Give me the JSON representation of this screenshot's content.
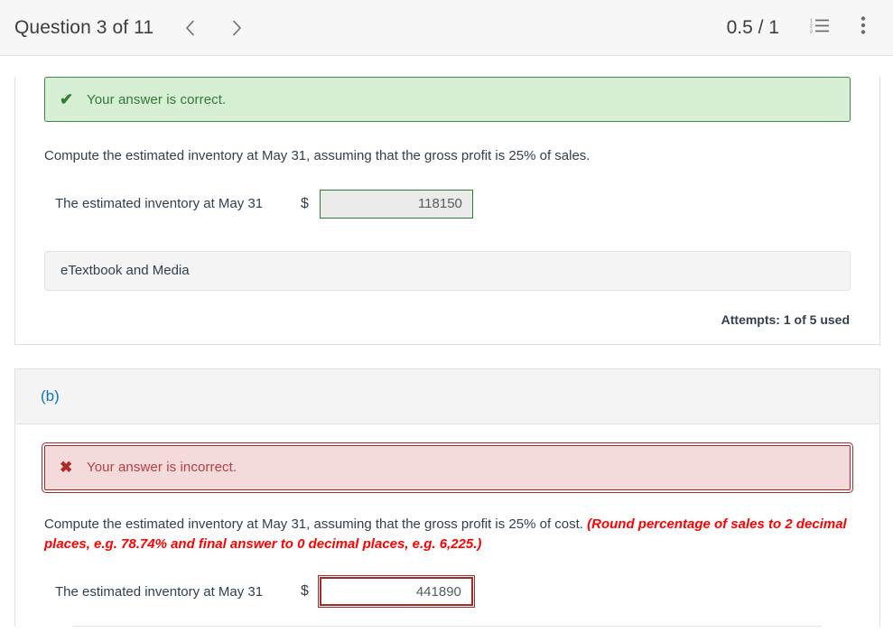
{
  "header": {
    "question_title": "Question 3 of 11",
    "prev_icon": "chevron-left-icon",
    "next_icon": "chevron-right-icon",
    "score": "0.5 / 1",
    "list_icon": "numbered-list-icon",
    "menu_icon": "kebab-menu-icon"
  },
  "part_a": {
    "alert": {
      "icon": "check-icon",
      "icon_glyph": "✔",
      "text": "Your answer is correct."
    },
    "prompt": "Compute the estimated inventory at May 31, assuming that the gross profit is 25% of sales.",
    "answer": {
      "label": "The estimated inventory at May 31",
      "currency": "$",
      "value": "118150",
      "placeholder": ""
    },
    "etextbook": "eTextbook and Media",
    "attempts": "Attempts: 1 of 5 used"
  },
  "part_b": {
    "label": "(b)",
    "alert": {
      "icon": "x-icon",
      "icon_glyph": "✖",
      "text": "Your answer is incorrect."
    },
    "prompt": "Compute the estimated inventory at May 31, assuming that the gross profit is 25% of cost.",
    "prompt_hint": "(Round percentage of sales to 2 decimal places, e.g. 78.74% and final answer to 0 decimal places, e.g. 6,225.)",
    "answer": {
      "label": "The estimated inventory at May 31",
      "currency": "$",
      "value": "441890",
      "placeholder": ""
    }
  },
  "colors": {
    "success_border": "#3a8a3f",
    "success_bg": "#d7f0d5",
    "success_text": "#2f7a35",
    "error_border": "#a52a2a",
    "error_bg": "#f5dadb",
    "error_text": "#b5403f",
    "hint_red": "#ff0000",
    "link_blue": "#0f76bc",
    "body_text": "#31404e"
  }
}
